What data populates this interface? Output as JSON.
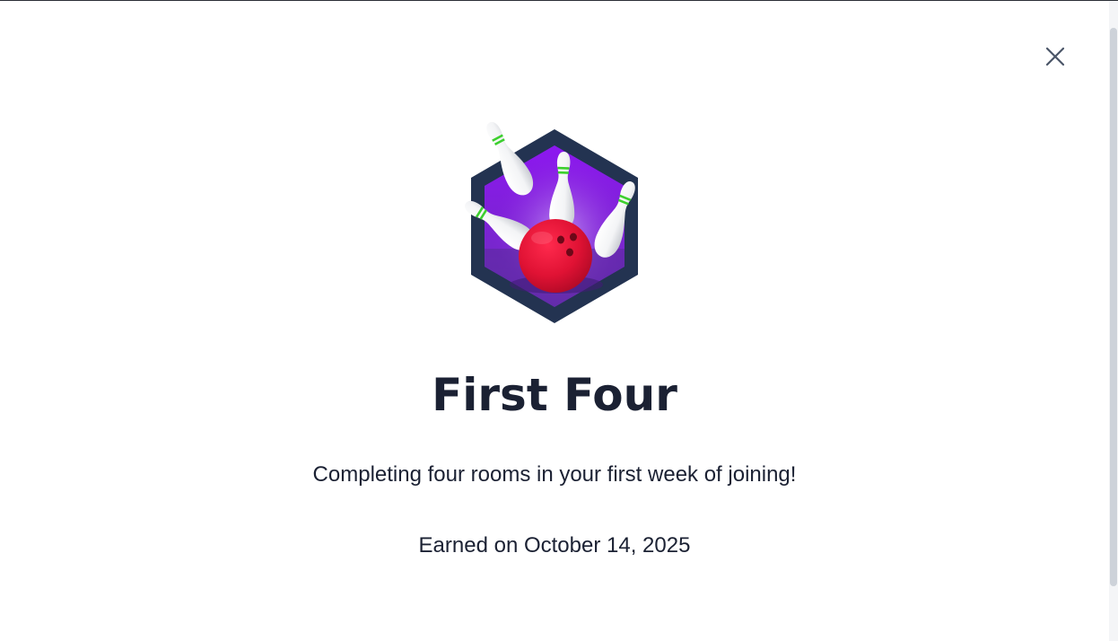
{
  "modal": {
    "title": "First Four",
    "description": "Completing four rooms in your first week of joining!",
    "earned_text": "Earned on October 14, 2025",
    "close_icon": "close-icon",
    "badge_icon": "bowling-strike-badge-icon"
  },
  "colors": {
    "title_text": "#1b2133",
    "hex_border": "#233351",
    "hex_fill": "#8a1fe0",
    "ball": "#e01234",
    "pin_stripe": "#3ccf2e"
  }
}
